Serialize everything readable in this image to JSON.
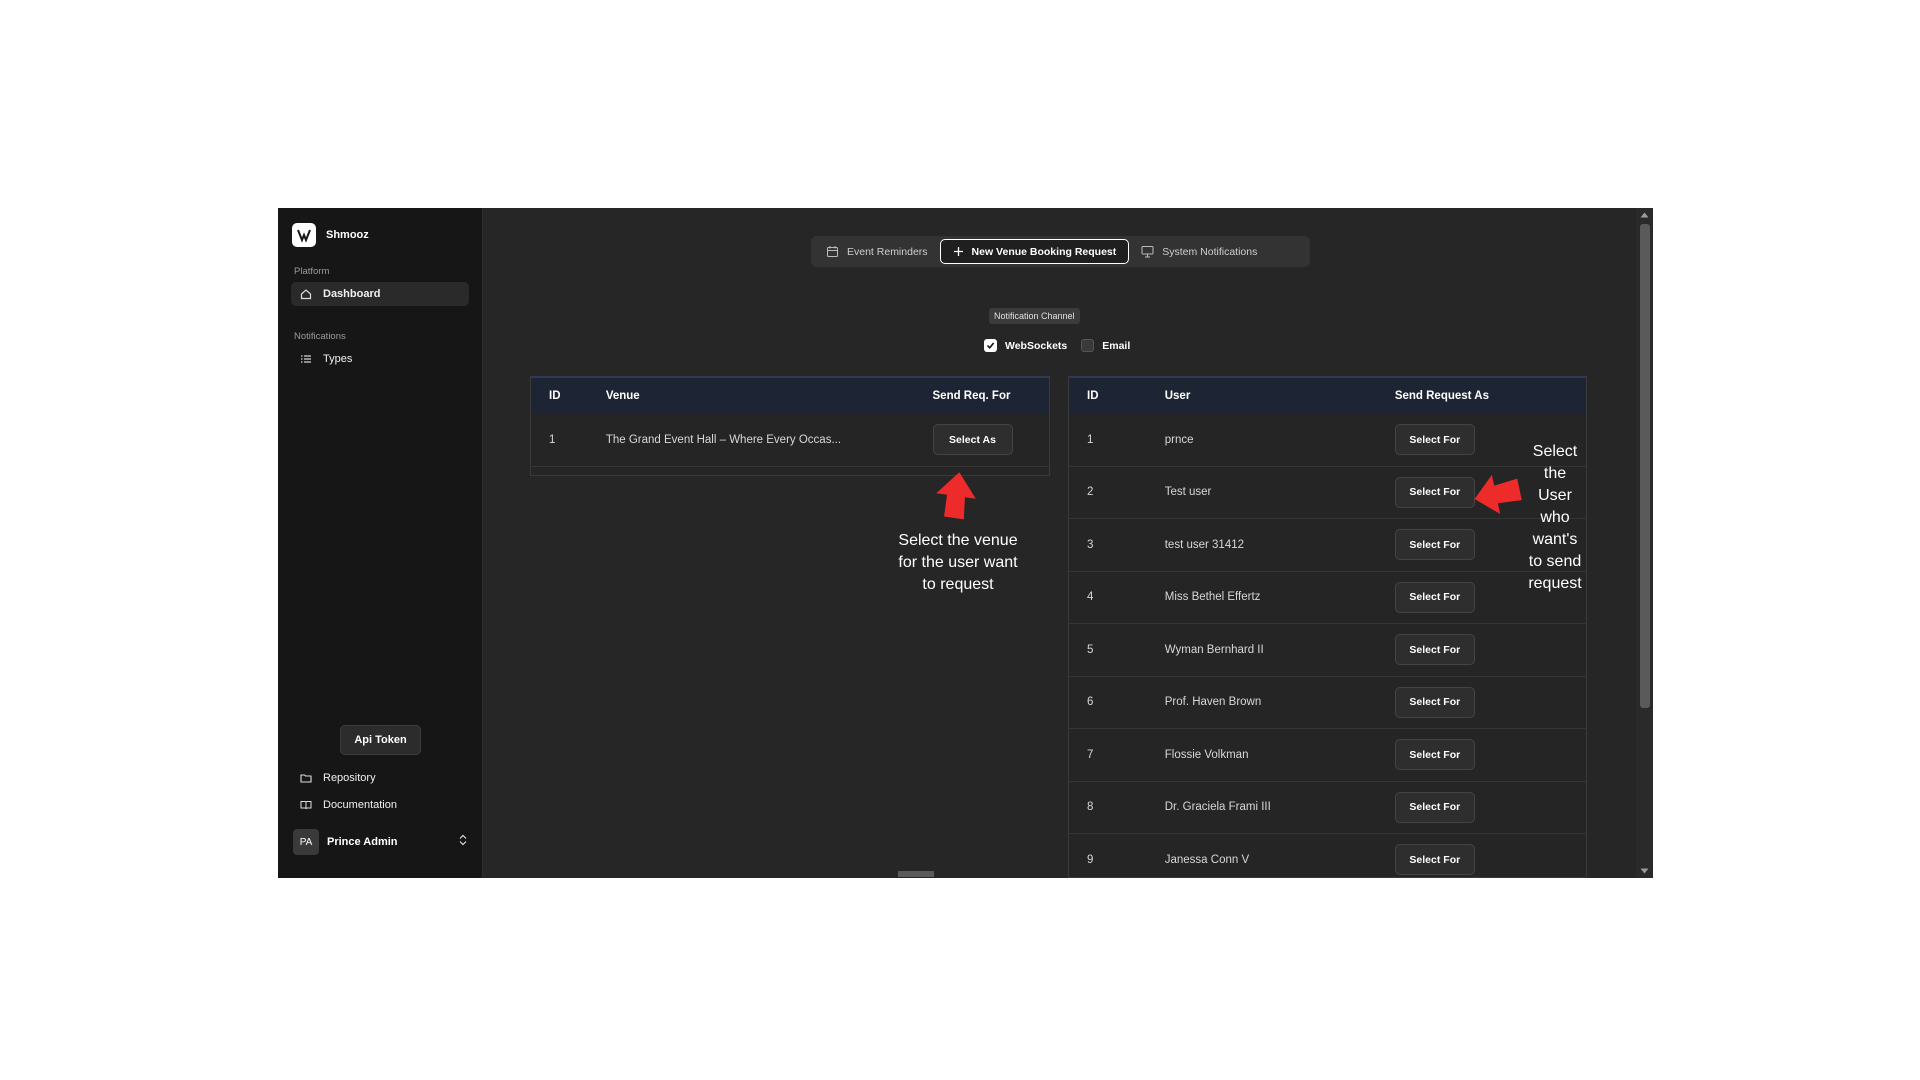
{
  "app": {
    "name": "Shmooz"
  },
  "sidebar": {
    "section_platform": "Platform",
    "dashboard": "Dashboard",
    "section_notifications": "Notifications",
    "types": "Types",
    "api_token": "Api Token",
    "repository": "Repository",
    "documentation": "Documentation",
    "user": {
      "initials": "PA",
      "name": "Prince Admin"
    }
  },
  "tabs": [
    {
      "label": "Event Reminders",
      "icon": "calendar-icon"
    },
    {
      "label": "New Venue Booking Request",
      "icon": "plus-icon",
      "active": true
    },
    {
      "label": "System Notifications",
      "icon": "monitor-icon"
    }
  ],
  "channel": {
    "label": "Notification Channel",
    "options": [
      {
        "label": "WebSockets",
        "checked": true
      },
      {
        "label": "Email",
        "checked": false
      }
    ]
  },
  "venues": {
    "headers": [
      "ID",
      "Venue",
      "Send Req. For"
    ],
    "rows": [
      {
        "id": "1",
        "name": "The Grand Event Hall – Where Every Occas...",
        "action": "Select As"
      }
    ]
  },
  "users": {
    "headers": [
      "ID",
      "User",
      "Send Request As"
    ],
    "rows": [
      {
        "id": "1",
        "name": "prnce",
        "action": "Select For"
      },
      {
        "id": "2",
        "name": "Test user",
        "action": "Select For"
      },
      {
        "id": "3",
        "name": "test user 31412",
        "action": "Select For"
      },
      {
        "id": "4",
        "name": "Miss Bethel Effertz",
        "action": "Select For"
      },
      {
        "id": "5",
        "name": "Wyman Bernhard II",
        "action": "Select For"
      },
      {
        "id": "6",
        "name": "Prof. Haven Brown",
        "action": "Select For"
      },
      {
        "id": "7",
        "name": "Flossie Volkman",
        "action": "Select For"
      },
      {
        "id": "8",
        "name": "Dr. Graciela Frami III",
        "action": "Select For"
      },
      {
        "id": "9",
        "name": "Janessa Conn V",
        "action": "Select For"
      }
    ]
  },
  "annotations": {
    "venue": [
      "Select the venue",
      "for the user want",
      "to request"
    ],
    "user": [
      "Select",
      "the",
      "User",
      "who",
      "want's",
      "to send",
      "request"
    ],
    "arrow_color": "#ee2b2b"
  },
  "colors": {
    "bg": "#262626",
    "sidebar": "#161616",
    "table_header": "#1d2535"
  }
}
